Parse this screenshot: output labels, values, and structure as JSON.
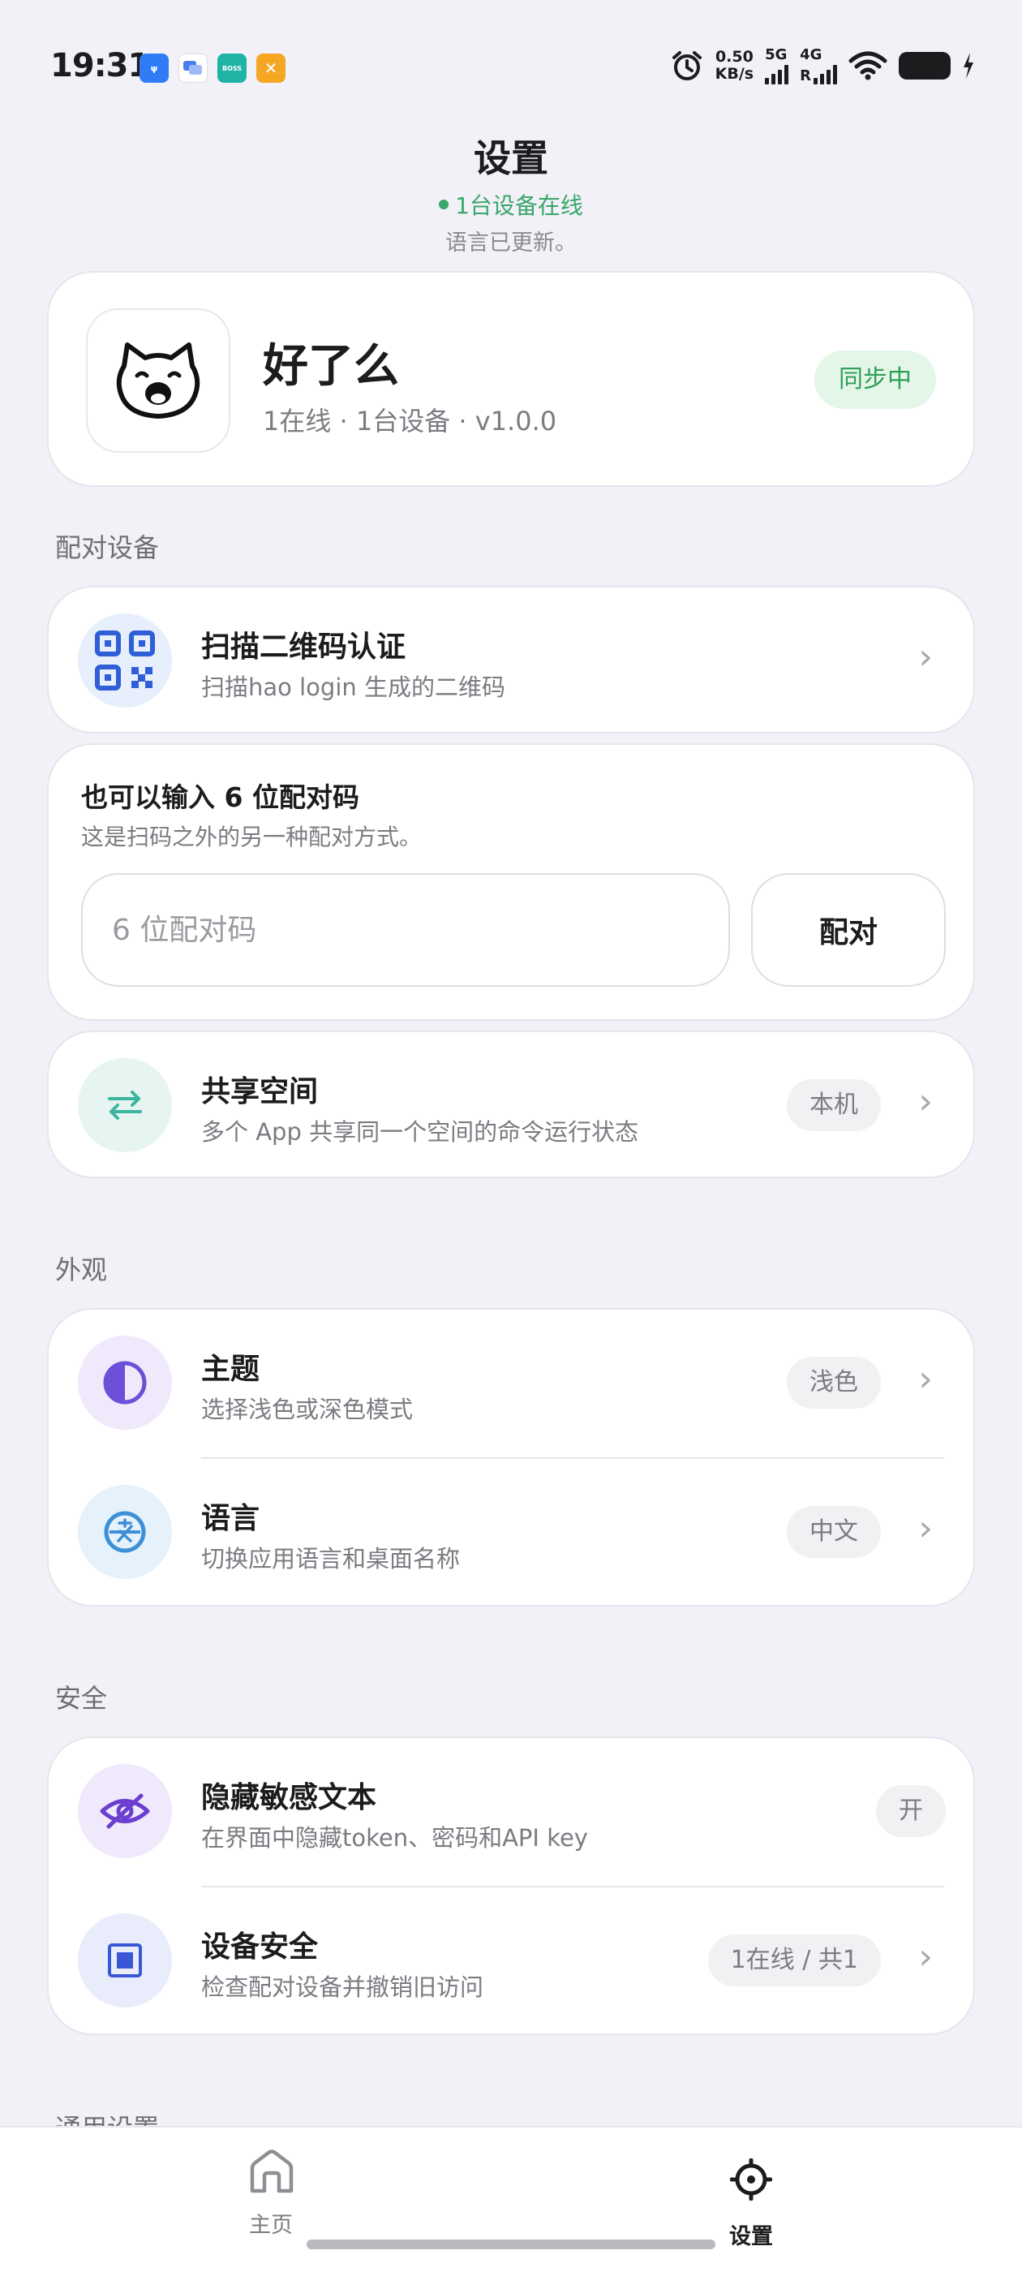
{
  "status_bar": {
    "time": "19:31",
    "apps": [
      {
        "icon": "usb-icon",
        "color": "#2f7cf6",
        "label": "ψ"
      },
      {
        "icon": "chat-icon",
        "color": "#ffffff",
        "label": ""
      },
      {
        "icon": "boss-app-icon",
        "color": "#1fb3a5",
        "label": "BOSS"
      },
      {
        "icon": "tools-app-icon",
        "color": "#f5a623",
        "label": "✕"
      }
    ],
    "net_speed_value": "0.50",
    "net_speed_unit": "KB/s",
    "sim1_type": "5G",
    "sim2_type": "4G",
    "sim2_roaming": "R"
  },
  "header": {
    "title": "设置",
    "online_status": "1台设备在线",
    "language_notice": "语言已更新。"
  },
  "profile": {
    "app_name": "好了么",
    "meta": "1在线 · 1台设备 · v1.0.0",
    "sync_badge": "同步中",
    "avatar_icon": "cat-avatar-icon"
  },
  "sections": {
    "pairing": "配对设备",
    "appearance": "外观",
    "security": "安全",
    "general": "通用设置"
  },
  "pairing": {
    "scan_title": "扫描二维码认证",
    "scan_sub": "扫描hao login 生成的二维码",
    "code_title": "也可以输入 6 位配对码",
    "code_sub": "这是扫码之外的另一种配对方式。",
    "code_placeholder": "6 位配对码",
    "pair_button": "配对",
    "shared_title": "共享空间",
    "shared_sub": "多个 App 共享同一个空间的命令运行状态",
    "shared_value": "本机"
  },
  "appearance": {
    "theme_title": "主题",
    "theme_sub": "选择浅色或深色模式",
    "theme_value": "浅色",
    "language_title": "语言",
    "language_sub": "切换应用语言和桌面名称",
    "language_value": "中文"
  },
  "security": {
    "hide_title": "隐藏敏感文本",
    "hide_sub": "在界面中隐藏token、密码和API key",
    "hide_value": "开",
    "device_title": "设备安全",
    "device_sub": "检查配对设备并撤销旧访问",
    "device_value": "1在线 / 共1"
  },
  "bottom_nav": {
    "home": "主页",
    "settings": "设置",
    "active": "settings"
  },
  "colors": {
    "accent_green": "#3aa66a",
    "qr_blue": "#2f5fd6",
    "shared_teal": "#3bb5a0",
    "theme_purple": "#6d4fd8",
    "language_blue": "#3d8fd6",
    "hide_purple": "#6a3fd0",
    "device_blue": "#3a57d6"
  }
}
